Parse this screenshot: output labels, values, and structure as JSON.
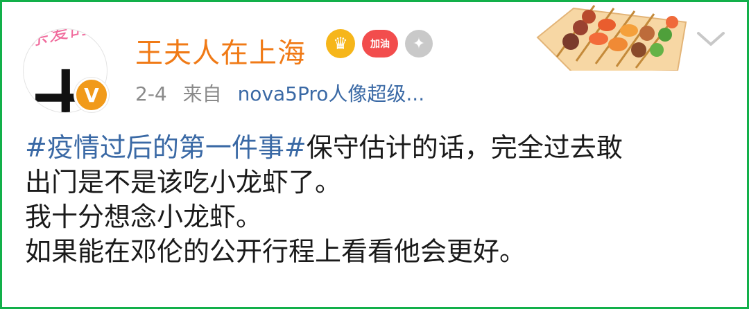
{
  "post": {
    "username": "王夫人在上海",
    "avatar_text": "亲爱的",
    "avatar_char": "土",
    "verify_icon": "V",
    "time": "2-4",
    "from": "来自",
    "device": "nova5Pro人像超级...",
    "content": {
      "hashtag": "#疫情过后的第一件事#",
      "line1_rest": "保守估计的话，完全过去敢",
      "line2": "出门是不是该吃小龙虾了。",
      "line3": "我十分想念小龙虾。",
      "line4": "如果能在邓伦的公开行程上看看他会更好。"
    },
    "badges": [
      "crown-badge-icon",
      "加油",
      "medal-badge-icon"
    ],
    "badge_heart_text": "加油"
  },
  "colors": {
    "frame": "#12b04a",
    "username": "#f07a16",
    "link": "#3a69a5",
    "meta": "#8a8a8a"
  }
}
